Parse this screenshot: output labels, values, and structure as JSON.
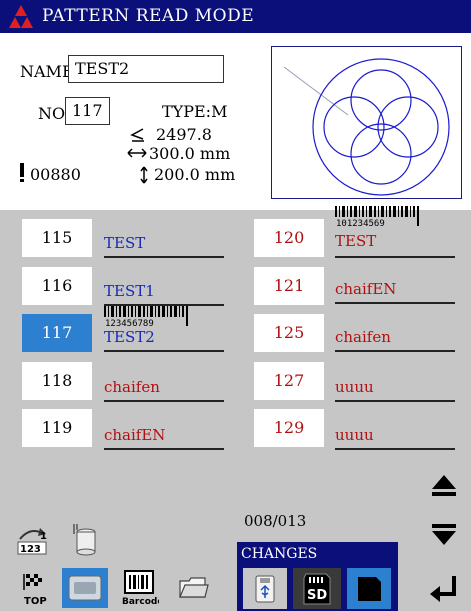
{
  "title": "PATTERN READ MODE",
  "info": {
    "name_label": "NAME",
    "name_value": "TEST2",
    "no_label": "NO",
    "no_value": "117",
    "type_text": "TYPE:M",
    "stitch_length": "2497.8",
    "width": "300.0 mm",
    "height": "200.0 mm",
    "stitch_count": "00880"
  },
  "list": {
    "left": [
      {
        "no": "115",
        "name": "TEST",
        "color": "blue",
        "barcode": ""
      },
      {
        "no": "116",
        "name": "TEST1",
        "color": "blue",
        "barcode": ""
      },
      {
        "no": "117",
        "name": "TEST2",
        "color": "blue",
        "barcode": "123456789",
        "selected": true
      },
      {
        "no": "118",
        "name": "chaifen",
        "color": "red",
        "barcode": ""
      },
      {
        "no": "119",
        "name": "chaifEN",
        "color": "red",
        "barcode": ""
      }
    ],
    "right": [
      {
        "no": "120",
        "name": "TEST",
        "color": "red",
        "barcode": "101234569"
      },
      {
        "no": "121",
        "name": "chaifEN",
        "color": "red",
        "barcode": ""
      },
      {
        "no": "125",
        "name": "chaifen",
        "color": "red",
        "barcode": ""
      },
      {
        "no": "127",
        "name": "uuuu",
        "color": "red",
        "barcode": ""
      },
      {
        "no": "129",
        "name": "uuuu",
        "color": "red",
        "barcode": ""
      }
    ]
  },
  "page_indicator": "008/013",
  "changes_label": "CHANGES",
  "buttons": {
    "top_label": "TOP",
    "barcode_label": "Barcode",
    "sd_label": "SD"
  },
  "colors": {
    "titlebar": "#0a0f7a",
    "selected": "#2d7fcf",
    "list_bg": "#c6c6c6",
    "name_blue": "#1428c0",
    "name_red": "#b01010"
  }
}
